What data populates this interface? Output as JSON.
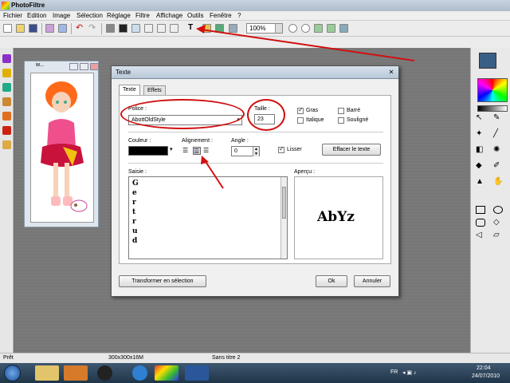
{
  "app": {
    "title": "PhotoFiltre"
  },
  "menu": [
    "Fichier",
    "Edition",
    "Image",
    "Sélection",
    "Réglage",
    "Filtre",
    "Affichage",
    "Outils",
    "Fenêtre",
    "?"
  ],
  "toolbar": {
    "zoom_value": "100%"
  },
  "image_window": {
    "title": "w..."
  },
  "dialog": {
    "title": "Texte",
    "tabs": [
      "Texte",
      "Effets"
    ],
    "police_label": "Police :",
    "police_value": "AbottOldStyle",
    "taille_label": "Taille :",
    "taille_value": "23",
    "gras_label": "Gras",
    "italique_label": "Italique",
    "barre_label": "Barré",
    "souligne_label": "Souligné",
    "couleur_label": "Couleur :",
    "alignement_label": "Alignement :",
    "angle_label": "Angle :",
    "angle_value": "0",
    "lisser_label": "Lisser",
    "effacer_button": "Effacer le texte",
    "saisie_label": "Saisie :",
    "saisie_lines": [
      "G",
      "e",
      "r",
      "t",
      "r",
      "u",
      "d"
    ],
    "apercu_label": "Aperçu :",
    "apercu_text": "AbYz",
    "transformer_button": "Transformer en sélection",
    "ok_button": "Ok",
    "annuler_button": "Annuler",
    "checks": {
      "gras": true,
      "italique": false,
      "barre": false,
      "souligne": false,
      "lisser": true
    }
  },
  "status": {
    "left": "Prêt",
    "size": "300x300x16M",
    "doc": "Sans titre 2"
  },
  "taskbar": {
    "lang": "FR",
    "time": "22:04",
    "date": "24/07/2010"
  },
  "colors": {
    "annotation": "#d01010",
    "swatch": "#3a5f85",
    "text_color": "#000000"
  }
}
